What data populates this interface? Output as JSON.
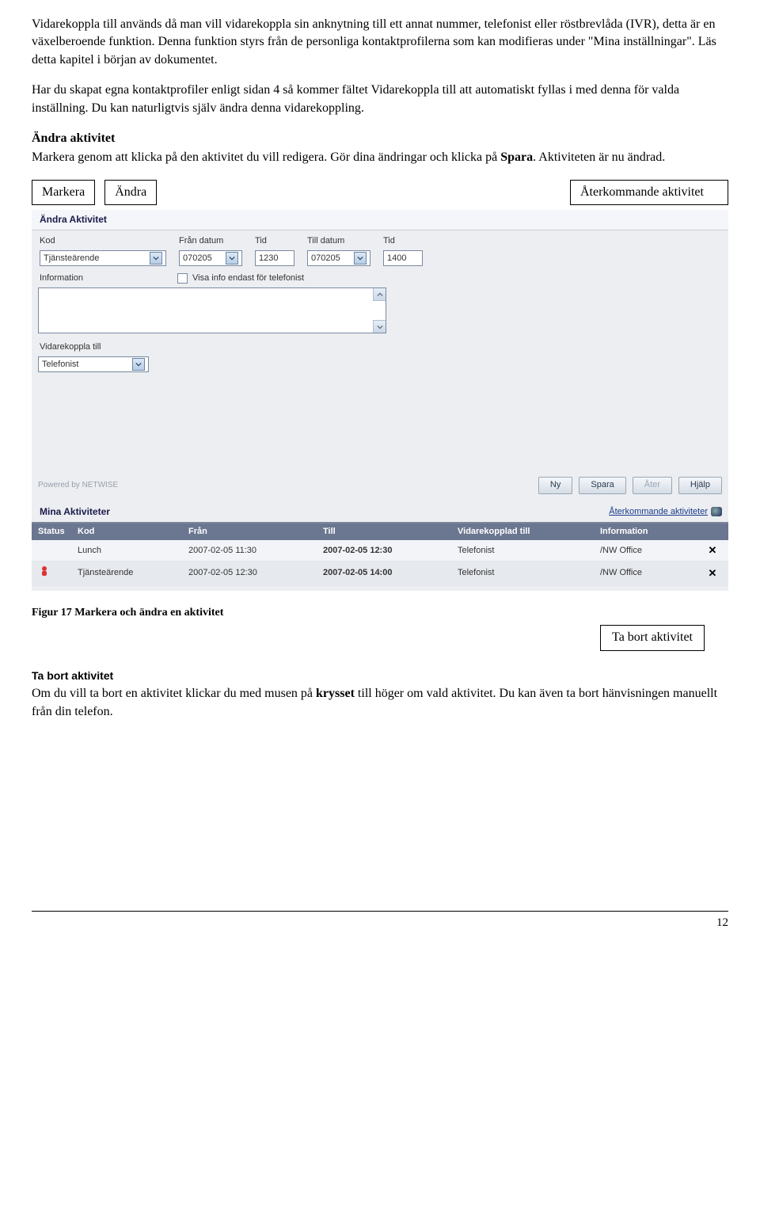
{
  "intro": {
    "p1a": "Vidarekoppla till används då man vill vidarekoppla sin anknytning till ett annat nummer, telefonist eller röstbrevlåda (IVR), detta är en växelberoende funktion.",
    "p1b": "Denna funktion styrs från de personliga kontaktprofilerna som kan modifieras under \"Mina inställningar\". Läs detta kapitel i början av dokumentet.",
    "p2": "Har du skapat egna kontaktprofiler enligt sidan 4 så kommer fältet Vidarekoppla till att automatiskt fyllas i med denna för valda inställning. Du kan naturligtvis själv ändra denna vidarekoppling."
  },
  "edit": {
    "heading": "Ändra aktivitet",
    "body_pre": "Markera genom att klicka på den aktivitet du vill redigera. Gör dina ändringar och klicka på ",
    "spara": "Spara",
    "body_post": ". Aktiviteten är nu ändrad."
  },
  "callouts": {
    "markera": "Markera",
    "andra": "Ändra",
    "aterkommande": "Återkommande aktivitet",
    "tabort": "Ta bort aktivitet"
  },
  "app": {
    "title": "Ändra Aktivitet",
    "labels": {
      "kod": "Kod",
      "from_date": "Från datum",
      "from_time": "Tid",
      "till_date": "Till datum",
      "till_time": "Tid",
      "information": "Information",
      "checkbox": "Visa info endast för telefonist",
      "vk": "Vidarekoppla till"
    },
    "values": {
      "kod": "Tjänsteärende",
      "from_date": "070205",
      "from_time": "1230",
      "till_date": "070205",
      "till_time": "1400",
      "vk": "Telefonist"
    },
    "powered": "Powered by NETWISE",
    "buttons": {
      "ny": "Ny",
      "spara": "Spara",
      "ater": "Åter",
      "hjalp": "Hjälp"
    }
  },
  "list": {
    "title": "Mina Aktiviteter",
    "link": "Återkommande aktiviteter",
    "headers": {
      "status": "Status",
      "kod": "Kod",
      "from": "Från",
      "till": "Till",
      "vk": "Vidarekopplad till",
      "info": "Information"
    },
    "rows": [
      {
        "kod": "Lunch",
        "from": "2007-02-05 11:30",
        "till": "2007-02-05 12:30",
        "vk": "Telefonist",
        "info": "/NW Office"
      },
      {
        "kod": "Tjänsteärende",
        "from": "2007-02-05 12:30",
        "till": "2007-02-05 14:00",
        "vk": "Telefonist",
        "info": "/NW Office"
      }
    ]
  },
  "figure_caption": "Figur 17  Markera och ändra en aktivitet",
  "remove": {
    "heading": "Ta bort aktivitet",
    "body_pre": "Om du vill ta bort en aktivitet klickar du med musen på ",
    "krysset": "krysset",
    "body_post": " till höger om vald aktivitet. Du kan även ta bort hänvisningen manuellt från din telefon."
  },
  "page_number": "12"
}
